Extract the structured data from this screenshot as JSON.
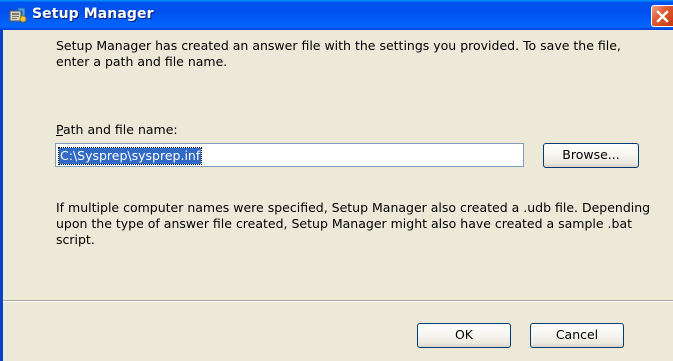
{
  "window": {
    "title": "Setup Manager",
    "icon": "setup-manager-app-icon",
    "close_icon": "close-icon"
  },
  "dialog": {
    "intro_text": "Setup Manager has created an answer file with the settings you provided. To save the file, enter a path and file name.",
    "path_label_accel": "P",
    "path_label_rest": "ath and file name:",
    "path_value": "C:\\Sysprep\\sysprep.inf",
    "browse_label": "Browse...",
    "note_text": "If multiple computer names were specified, Setup Manager also created a .udb file. Depending upon the type of answer file created, Setup Manager might also have created a sample .bat script.",
    "ok_label": "OK",
    "cancel_label": "Cancel"
  },
  "colors": {
    "title_bar": "#0054E3",
    "dialog_background": "#ECE9D8",
    "selection": "#316AC5",
    "close_button": "#E25B31",
    "button_border": "#003C74"
  }
}
